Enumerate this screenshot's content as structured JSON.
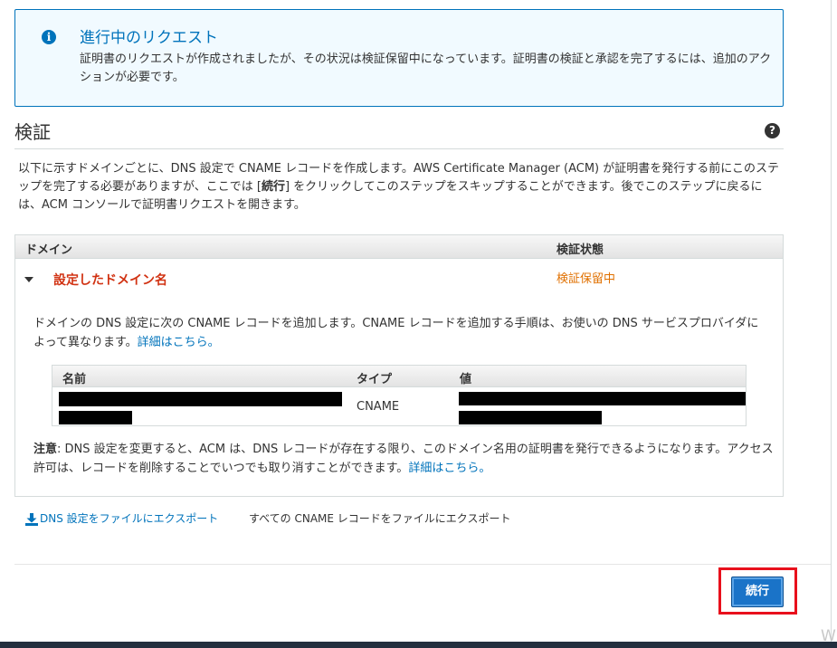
{
  "notice": {
    "title": "進行中のリクエスト",
    "body": "証明書のリクエストが作成されましたが、その状況は検証保留中になっています。証明書の検証と承認を完了するには、追加のアクションが必要です。"
  },
  "section": {
    "title": "検証",
    "intro_before": "以下に示すドメインごとに、DNS 設定で CNAME レコードを作成します。AWS Certificate Manager (ACM) が証明書を発行する前にこのステップを完了する必要がありますが、ここでは [",
    "intro_bold": "続行",
    "intro_after": "] をクリックしてこのステップをスキップすることができます。後でこのステップに戻るには、ACM コンソールで証明書リクエストを開きます。"
  },
  "domain_table": {
    "col_domain": "ドメイン",
    "col_status": "検証状態",
    "domain_name": "設定したドメイン名",
    "status": "検証保留中"
  },
  "cname": {
    "description": "ドメインの DNS 設定に次の CNAME レコードを追加します。CNAME レコードを追加する手順は、お使いの DNS サービスプロバイダによって異なります。",
    "details_link": "詳細はこちら。",
    "col_name": "名前",
    "col_type": "タイプ",
    "col_value": "値",
    "record_type": "CNAME"
  },
  "note": {
    "label": "注意",
    "text": ": DNS 設定を変更すると、ACM は、DNS レコードが存在する限り、このドメイン名用の証明書を発行できるようになります。アクセス許可は、レコードを削除することでいつでも取り消すことができます。",
    "details_link": "詳細はこちら。"
  },
  "export": {
    "dns_link": "DNS 設定をファイルにエクスポート",
    "all_cname": "すべての CNAME レコードをファイルにエクスポート"
  },
  "actions": {
    "continue_label": "続行"
  },
  "colors": {
    "accent": "#0073bb",
    "domain_name": "#d13212",
    "status_pending": "#e07000",
    "highlight": "#e8101c"
  }
}
